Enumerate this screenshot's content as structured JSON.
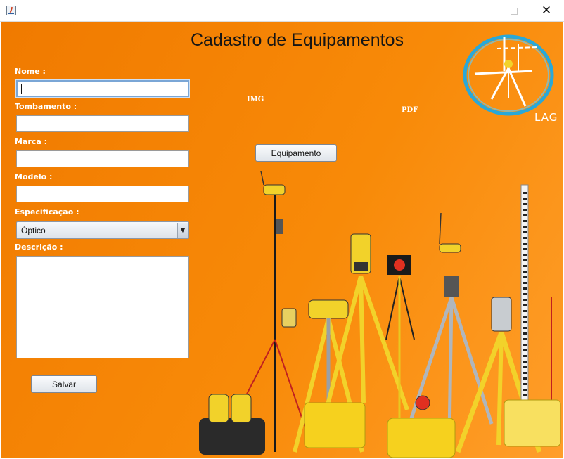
{
  "window": {
    "title_bar": {
      "app_icon": "java-app-icon",
      "controls": {
        "minimize": "minimize-icon",
        "maximize": "maximize-icon",
        "close": "close-icon",
        "close_glyph": "✕"
      }
    }
  },
  "form": {
    "title": "Cadastro de Equipamentos",
    "fields": {
      "nome": {
        "label": "Nome :",
        "value": ""
      },
      "tombamento": {
        "label": "Tombamento :",
        "value": ""
      },
      "marca": {
        "label": "Marca :",
        "value": ""
      },
      "modelo": {
        "label": "Modelo :",
        "value": ""
      },
      "especificacao": {
        "label": "Especificação :",
        "selected": "Óptico",
        "arrow": "▼"
      },
      "descricao": {
        "label": "Descrição :",
        "value": ""
      }
    },
    "buttons": {
      "equipamento": "Equipamento",
      "salvar": "Salvar"
    },
    "labels": {
      "img": "IMG",
      "pdf": "PDF"
    },
    "logo": {
      "text": "LAG"
    }
  },
  "colors": {
    "background_orange": "#f88a08",
    "logo_ring": "#2aa8d8",
    "tripod_yellow": "#f2d22a",
    "case_yellow": "#f6d11e"
  }
}
